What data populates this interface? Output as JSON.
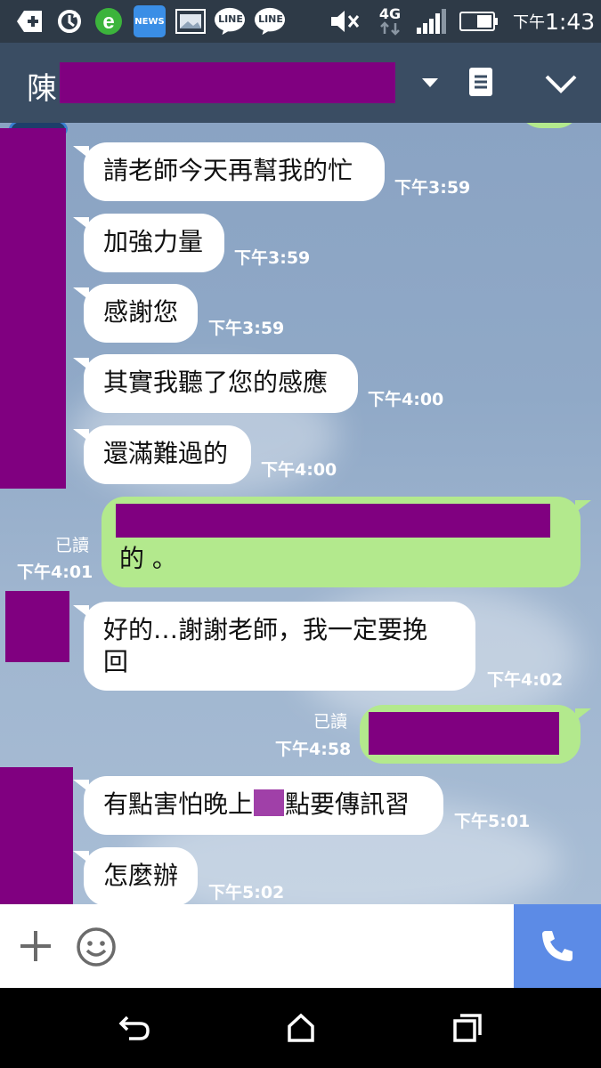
{
  "status_bar": {
    "news_label": "NEWS",
    "line_label_1": "LINE",
    "line_label_2": "LINE",
    "network": "4G",
    "time_prefix": "下午",
    "time": "1:43"
  },
  "header": {
    "name_initial": "陳"
  },
  "messages": [
    {
      "text": "請老師今天再幫我的忙",
      "time": "下午3:59"
    },
    {
      "text": "加強力量",
      "time": "下午3:59"
    },
    {
      "text": "感謝您",
      "time": "下午3:59"
    },
    {
      "text": "其實我聽了您的感應",
      "time": "下午4:00"
    },
    {
      "text": "還滿難過的",
      "time": "下午4:00"
    },
    {
      "text_tail": "的 。",
      "read": "已讀",
      "time": "下午4:01"
    },
    {
      "line1": "好的…謝謝老師，我一定要挽",
      "line2": "回",
      "time": "下午4:02"
    },
    {
      "read": "已讀",
      "time": "下午4:58"
    },
    {
      "before": "有點害怕晚上",
      "after": "點要傳訊習",
      "time": "下午5:01"
    },
    {
      "text": "怎麼辦",
      "time": "下午5:02"
    }
  ],
  "colors": {
    "redaction": "#800080",
    "sent_bubble": "#b3e98d",
    "call_button": "#5c8be6"
  }
}
